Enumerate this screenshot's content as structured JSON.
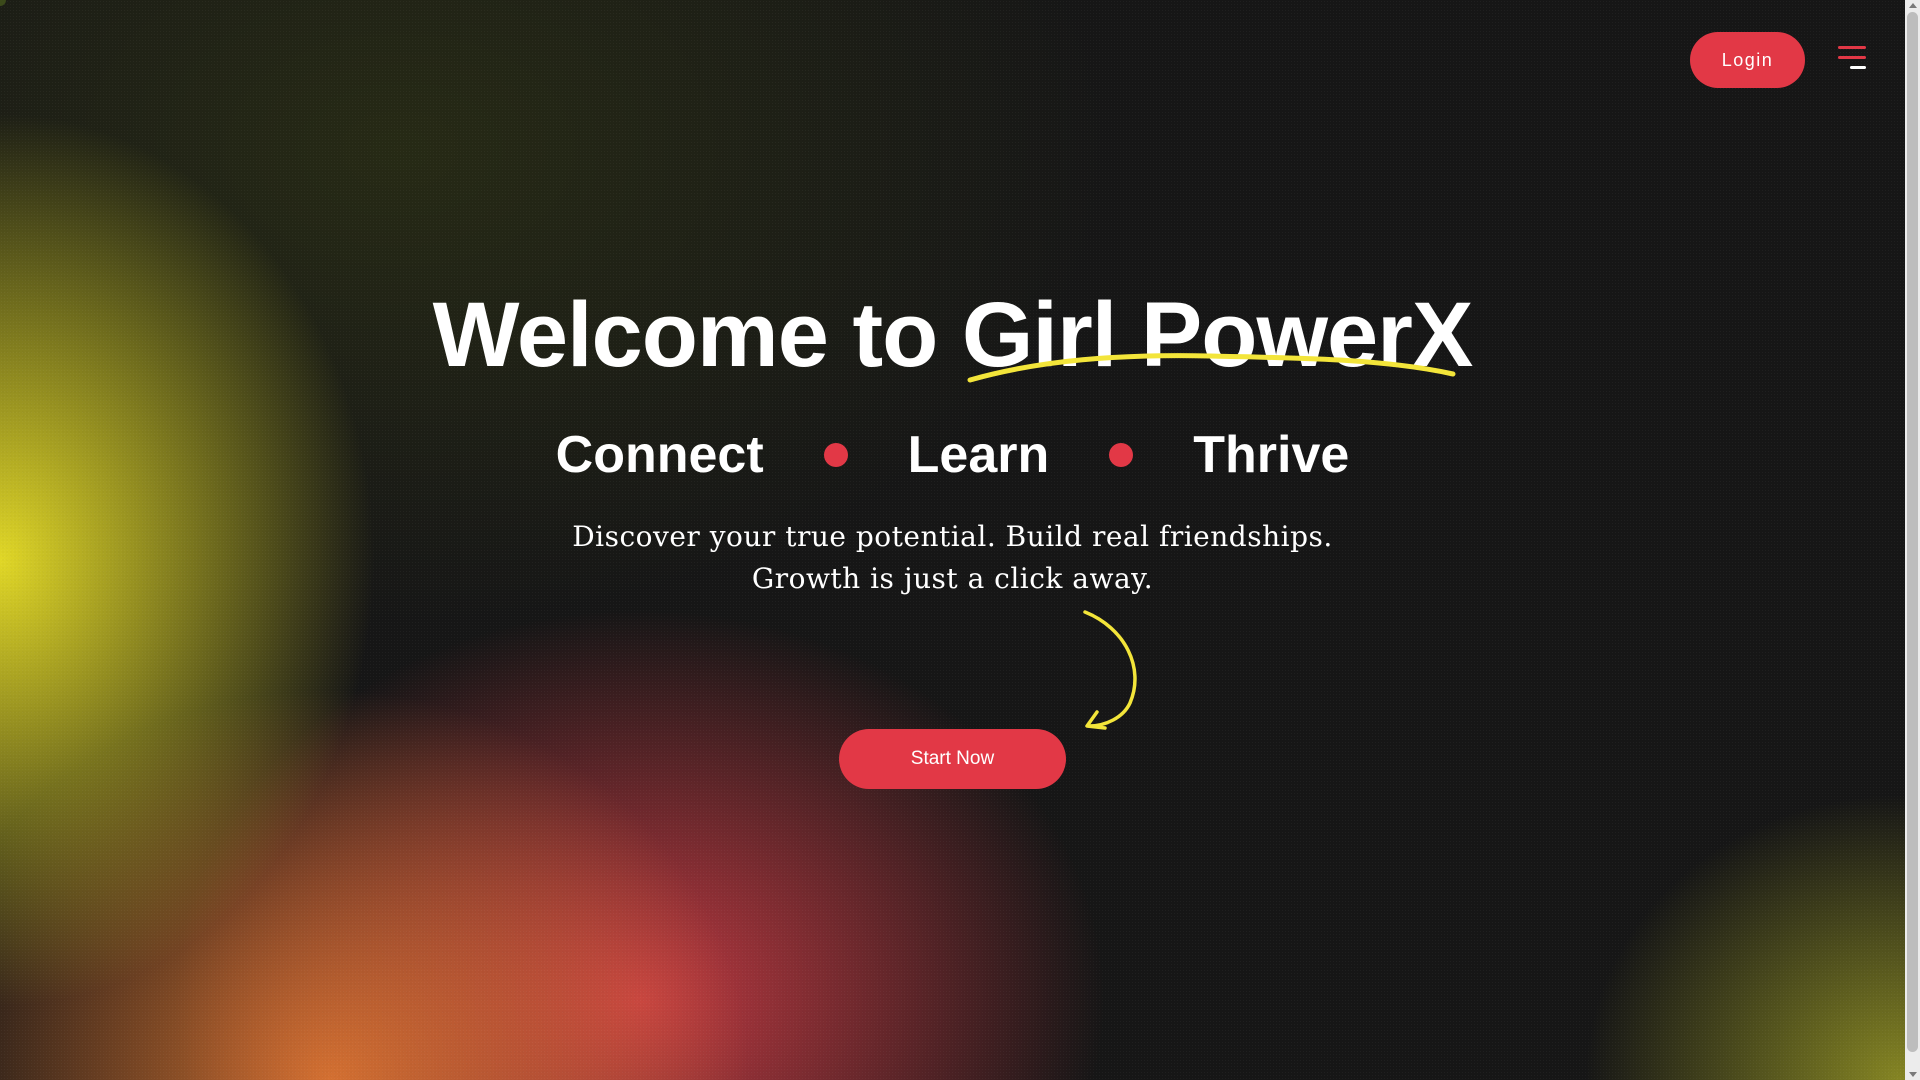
{
  "header": {
    "login_label": "Login",
    "menu_icon": "hamburger-menu-icon"
  },
  "hero": {
    "title": "Welcome to Girl PowerX",
    "pillars": [
      "Connect",
      "Learn",
      "Thrive"
    ],
    "tagline_line1": "Discover your true potential. Build real friendships.",
    "tagline_line2": "Growth is just a click away.",
    "cta_label": "Start Now"
  },
  "colors": {
    "accent": "#e23846",
    "highlight": "#f3e53a",
    "background": "#161616",
    "text": "#ffffff"
  }
}
